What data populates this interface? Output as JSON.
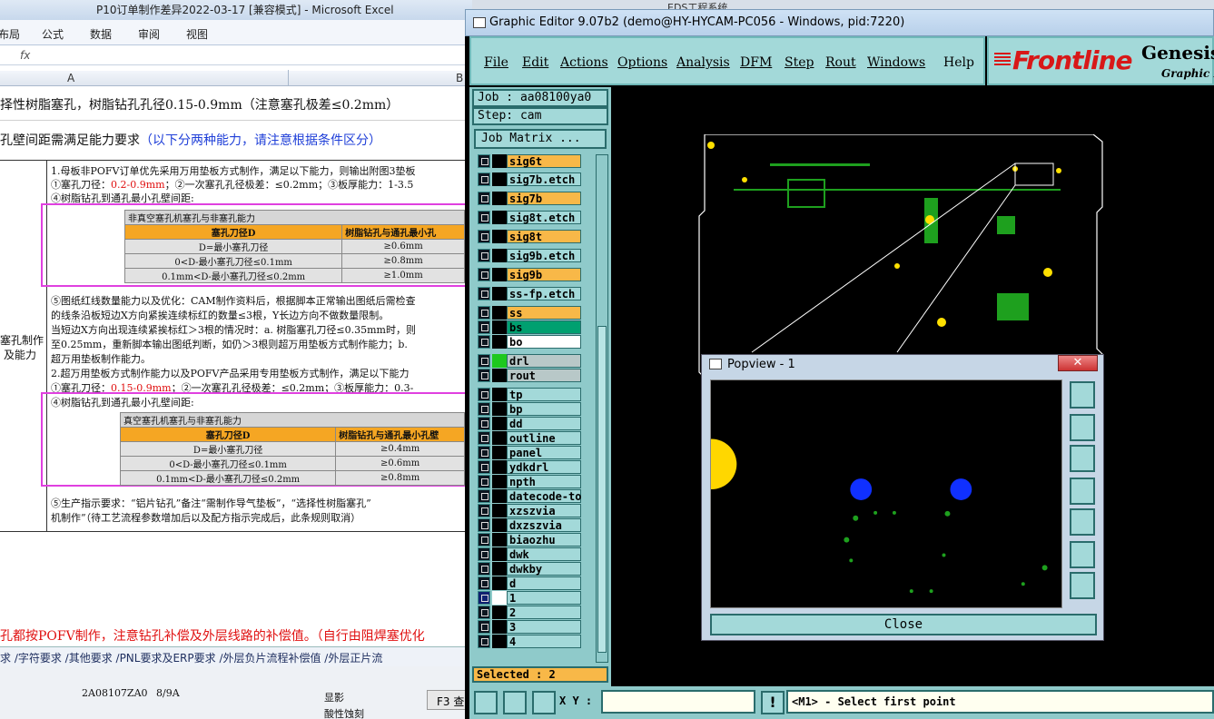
{
  "excel": {
    "title": "P10订单制作差异2022-03-17  [兼容模式] - Microsoft Excel",
    "menu": [
      "布局",
      "公式",
      "数据",
      "审阅",
      "视图"
    ],
    "fx": "fx",
    "col_a": "A",
    "col_b": "B",
    "line1": "择性树脂塞孔，树脂钻孔孔径0.15-0.9mm（注意塞孔极差≤0.2mm）",
    "line2_black": "孔壁间距需满足能力要求",
    "line2_blue": "（以下分两种能力，请注意根据条件区分）",
    "rowlabel1": "塞孔制作",
    "rowlabel2": "及能力",
    "p1": "1.母板非POFV订单优先采用万用垫板方式制作，满足以下能力，则输出附图3垫板",
    "p1b_a": "①塞孔刀径：",
    "p1b_b": "0.2-0.9mm",
    "p1b_c": "；②一次塞孔孔径极差：≤0.2mm；③板厚能力：1-3.5",
    "p1c": "④树脂钻孔到通孔最小孔壁间距:",
    "t1": {
      "caption": "非真空塞孔机塞孔与非塞孔能力",
      "head": [
        "塞孔刀径D",
        "树脂钻孔与通孔最小孔"
      ],
      "rows": [
        [
          "D=最小塞孔刀径",
          "≥0.6mm"
        ],
        [
          "0<D-最小塞孔刀径≤0.1mm",
          "≥0.8mm"
        ],
        [
          "0.1mm<D-最小塞孔刀径≤0.2mm",
          "≥1.0mm"
        ]
      ]
    },
    "p2a": "⑤图纸红线数量能力以及优化：CAM制作资料后，根据脚本正常输出图纸后需检查",
    "p2b": "的线条沿板短边X方向紧挨连续标红的数量≤3根，Y长边方向不做数量限制。",
    "p2c": "当短边X方向出现连续紧挨标红＞3根的情况时：a. 树脂塞孔刀径≤0.35mm时，则",
    "p2d": "至0.25mm，重新脚本输出图纸判断，如仍＞3根则超万用垫板方式制作能力；b.",
    "p2e": "超万用垫板制作能力。",
    "p3": "2.超万用垫板方式制作能力以及POFV产品采用专用垫板方式制作，满足以下能力",
    "p3b_a": "①塞孔刀径：",
    "p3b_b": "0.15-0.9mm",
    "p3b_c": "；②一次塞孔孔径极差：≤0.2mm；③板厚能力：0.3-",
    "p3c": "④树脂钻孔到通孔最小孔壁间距:",
    "t2": {
      "caption": "真空塞孔机塞孔与非塞孔能力",
      "head": [
        "塞孔刀径D",
        "树脂钻孔与通孔最小孔壁"
      ],
      "rows": [
        [
          "D=最小塞孔刀径",
          "≥0.4mm"
        ],
        [
          "0<D-最小塞孔刀径≤0.1mm",
          "≥0.6mm"
        ],
        [
          "0.1mm<D-最小塞孔刀径≤0.2mm",
          "≥0.8mm"
        ]
      ]
    },
    "p4a": "⑤生产指示要求：“铝片钻孔”备注“需制作导气垫板”，“选择性树脂塞孔”",
    "p4b": "机制作”（待工艺流程参数增加后以及配方指示完成后，此条规则取消）",
    "bottom_red": "孔都按POFV制作，注意钻孔补偿及外层线路的补偿值。（自行由阻焊塞优化",
    "tabs": "求 ∕字符要求 ∕其他要求 ∕PNL要求及ERP要求 ∕外层负片流程补偿值 ∕外层正片流",
    "bg_rows": [
      [
        "2A08107ZA0",
        "8/9A"
      ]
    ],
    "bg_tree": [
      "显影",
      "酸性蚀刻"
    ],
    "bg_btn": "F3 查"
  },
  "eds_title": "EDS工程系统",
  "genesis": {
    "title": "Graphic Editor 9.07b2 (demo@HY-HYCAM-PC056 - Windows, pid:7220)",
    "menu": [
      "File",
      "Edit",
      "Actions",
      "Options",
      "Analysis",
      "DFM",
      "Step",
      "Rout",
      "Windows",
      "Help"
    ],
    "logo": "Frontline",
    "logo2": "Genesis",
    "logo3": "Graphic E",
    "job": "Job : aa08100ya0",
    "step": "Step: cam",
    "job_matrix": "Job Matrix ...",
    "layers": [
      {
        "name": "sig6t",
        "color": "#f8b848"
      },
      {
        "name": "sig7b.etch",
        "color": "#a3d9d9"
      },
      {
        "name": "sig7b",
        "color": "#f8b848"
      },
      {
        "name": "sig8t.etch",
        "color": "#a3d9d9"
      },
      {
        "name": "sig8t",
        "color": "#f8b848"
      },
      {
        "name": "sig9b.etch",
        "color": "#a3d9d9"
      },
      {
        "name": "sig9b",
        "color": "#f8b848"
      },
      {
        "name": "ss-fp.etch",
        "color": "#a3d9d9"
      },
      {
        "name": "ss",
        "color": "#f8b848"
      },
      {
        "name": "bs",
        "color": "#00a070"
      },
      {
        "name": "bo",
        "color": "#ffffff"
      },
      {
        "name": "drl",
        "color": "#b8c8c8"
      },
      {
        "name": "rout",
        "color": "#b8c8c8"
      },
      {
        "name": "tp",
        "color": "#a3d9d9"
      },
      {
        "name": "bp",
        "color": "#a3d9d9"
      },
      {
        "name": "dd",
        "color": "#a3d9d9"
      },
      {
        "name": "outline",
        "color": "#a3d9d9"
      },
      {
        "name": "panel",
        "color": "#a3d9d9"
      },
      {
        "name": "ydkdrl",
        "color": "#a3d9d9"
      },
      {
        "name": "npth",
        "color": "#a3d9d9"
      },
      {
        "name": "datecode-to",
        "color": "#a3d9d9"
      },
      {
        "name": "xzszvia",
        "color": "#a3d9d9"
      },
      {
        "name": "dxzszvia",
        "color": "#a3d9d9"
      },
      {
        "name": "biaozhu",
        "color": "#a3d9d9"
      },
      {
        "name": "dwk",
        "color": "#a3d9d9"
      },
      {
        "name": "dwkby",
        "color": "#a3d9d9"
      },
      {
        "name": "d",
        "color": "#a3d9d9"
      },
      {
        "name": "1",
        "color": "#a3d9d9"
      },
      {
        "name": "2",
        "color": "#a3d9d9"
      },
      {
        "name": "3",
        "color": "#a3d9d9"
      },
      {
        "name": "4",
        "color": "#a3d9d9"
      }
    ],
    "selected": "Selected : 2",
    "xy_label": "X Y :",
    "status": "<M1> - Select first point",
    "popview": {
      "title": "Popview - 1",
      "close": "Close"
    }
  }
}
